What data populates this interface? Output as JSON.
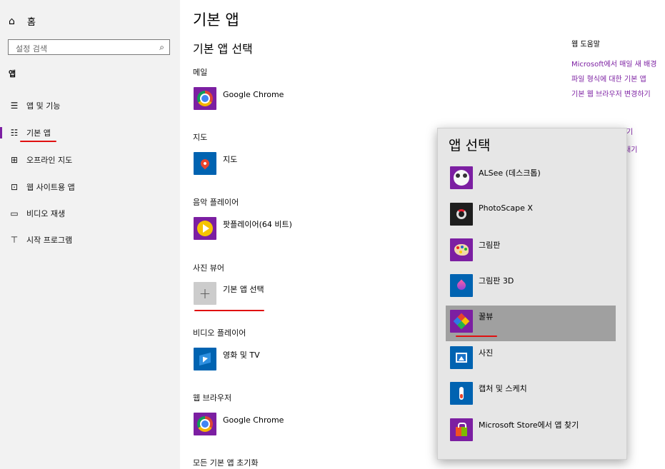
{
  "sidebar": {
    "home_icon": "home-icon",
    "home_label": "홈",
    "search_placeholder": "설정 검색",
    "search_icon": "search-icon",
    "section_label": "앱",
    "items": [
      {
        "label": "앱 및 기능",
        "icon": "apps-list-icon"
      },
      {
        "label": "기본 앱",
        "icon": "default-apps-icon"
      },
      {
        "label": "오프라인 지도",
        "icon": "map-icon"
      },
      {
        "label": "웹 사이트용 앱",
        "icon": "website-app-icon"
      },
      {
        "label": "비디오 재생",
        "icon": "video-icon"
      },
      {
        "label": "시작 프로그램",
        "icon": "startup-icon"
      }
    ]
  },
  "main": {
    "title": "기본 앱",
    "subtitle": "기본 앱 선택",
    "categories": [
      {
        "label": "메일",
        "app": "Google Chrome"
      },
      {
        "label": "지도",
        "app": "지도"
      },
      {
        "label": "음악 플레이어",
        "app": "팟플레이어(64 비트)"
      },
      {
        "label": "사진 뷰어",
        "app": "기본 앱 선택"
      },
      {
        "label": "비디오 플레이어",
        "app": "영화 및 TV"
      },
      {
        "label": "웹 브라우저",
        "app": "Google Chrome"
      }
    ],
    "reset_label": "모든 기본 앱 초기화"
  },
  "right_panel": {
    "heading": "웹 도움말",
    "links": [
      "Microsoft에서 매일 새 배경",
      "파일 형식에 대한 기본 앱",
      "기본 웹 브라우저 변경하기",
      "기",
      "내기"
    ]
  },
  "flyout": {
    "title": "앱 선택",
    "items": [
      {
        "label": "ALSee (데스크톱)",
        "icon": "alsee-icon"
      },
      {
        "label": "PhotoScape X",
        "icon": "photoscape-icon"
      },
      {
        "label": "그림판",
        "icon": "paint-icon"
      },
      {
        "label": "그림판 3D",
        "icon": "paint3d-icon"
      },
      {
        "label": "꿀뷰",
        "icon": "honeyview-icon",
        "selected": true
      },
      {
        "label": "사진",
        "icon": "photos-icon"
      },
      {
        "label": "캡처 및 스케치",
        "icon": "snip-sketch-icon"
      },
      {
        "label": "Microsoft Store에서 앱 찾기",
        "icon": "store-icon"
      }
    ]
  },
  "colors": {
    "accent": "#7c1fa2",
    "annotation": "#e01010",
    "sidebar_bg": "#f2f2f2",
    "flyout_bg": "#e6e6e6",
    "selected_bg": "#a0a0a0"
  }
}
